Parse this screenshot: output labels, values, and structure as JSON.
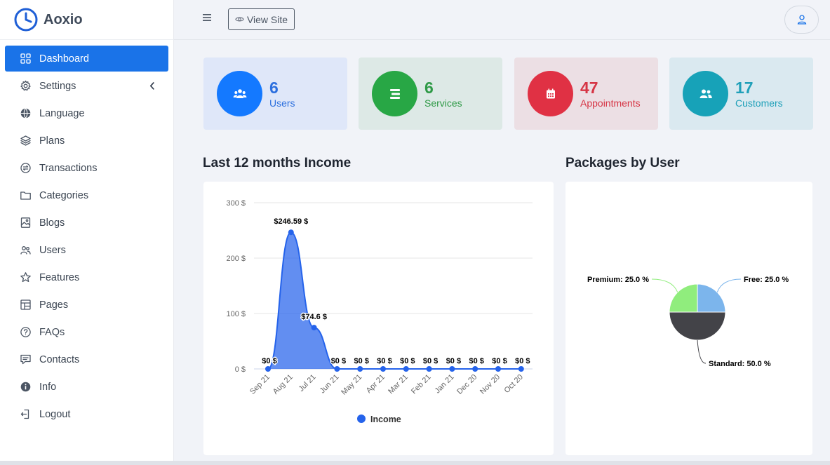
{
  "brand": {
    "name": "Aoxio"
  },
  "topbar": {
    "view_site_label": "View Site"
  },
  "sidebar": {
    "items": [
      {
        "label": "Dashboard",
        "icon": "dashboard-icon",
        "active": true
      },
      {
        "label": "Settings",
        "icon": "gear-icon",
        "has_submenu": true
      },
      {
        "label": "Language",
        "icon": "globe-icon"
      },
      {
        "label": "Plans",
        "icon": "layers-icon"
      },
      {
        "label": "Transactions",
        "icon": "exchange-icon"
      },
      {
        "label": "Categories",
        "icon": "folder-icon"
      },
      {
        "label": "Blogs",
        "icon": "image-icon"
      },
      {
        "label": "Users",
        "icon": "users-icon"
      },
      {
        "label": "Features",
        "icon": "star-icon"
      },
      {
        "label": "Pages",
        "icon": "layout-icon"
      },
      {
        "label": "FAQs",
        "icon": "question-icon"
      },
      {
        "label": "Contacts",
        "icon": "message-icon"
      },
      {
        "label": "Info",
        "icon": "info-icon"
      },
      {
        "label": "Logout",
        "icon": "logout-icon"
      }
    ]
  },
  "stats": [
    {
      "value": "6",
      "label": "Users",
      "icon": "users-icon",
      "bg": "#dfe7f9",
      "accent": "#1479ff",
      "text": "#2c6fde"
    },
    {
      "value": "6",
      "label": "Services",
      "icon": "list-icon",
      "bg": "#dde9e6",
      "accent": "#28a745",
      "text": "#2f9a47"
    },
    {
      "value": "47",
      "label": "Appointments",
      "icon": "calendar-icon",
      "bg": "#ecdfe4",
      "accent": "#e03144",
      "text": "#d63545"
    },
    {
      "value": "17",
      "label": "Customers",
      "icon": "customers-icon",
      "bg": "#dae9f0",
      "accent": "#17a2b8",
      "text": "#1fa0b9"
    }
  ],
  "sections": {
    "income_title": "Last 12 months Income",
    "packages_title": "Packages by User"
  },
  "chart_data": [
    {
      "type": "area",
      "categories": [
        "Sep 21",
        "Aug 21",
        "Jul 21",
        "Jun 21",
        "May 21",
        "Apr 21",
        "Mar 21",
        "Feb 21",
        "Jan 21",
        "Dec 20",
        "Nov 20",
        "Oct 20"
      ],
      "series": [
        {
          "name": "Income",
          "values": [
            0,
            246.59,
            74.6,
            0,
            0,
            0,
            0,
            0,
            0,
            0,
            0,
            0
          ]
        }
      ],
      "data_labels": [
        "$0 $",
        "$246.59 $",
        "$74.6 $",
        "$0 $",
        "$0 $",
        "$0 $",
        "$0 $",
        "$0 $",
        "$0 $",
        "$0 $",
        "$0 $",
        "$0 $"
      ],
      "ylim": [
        0,
        300
      ],
      "yticks": [
        {
          "value": 0,
          "label": "0 $"
        },
        {
          "value": 100,
          "label": "100 $"
        },
        {
          "value": 200,
          "label": "200 $"
        },
        {
          "value": 300,
          "label": "300 $"
        }
      ],
      "grid": true,
      "legend": "bottom-center",
      "color": "#2563eb"
    },
    {
      "type": "pie",
      "slices": [
        {
          "name": "Free",
          "value": 25.0,
          "label": "Free: 25.0 %",
          "color": "#7cb5ec"
        },
        {
          "name": "Standard",
          "value": 50.0,
          "label": "Standard: 50.0 %",
          "color": "#434348"
        },
        {
          "name": "Premium",
          "value": 25.0,
          "label": "Premium: 25.0 %",
          "color": "#90ed7d"
        }
      ]
    }
  ]
}
